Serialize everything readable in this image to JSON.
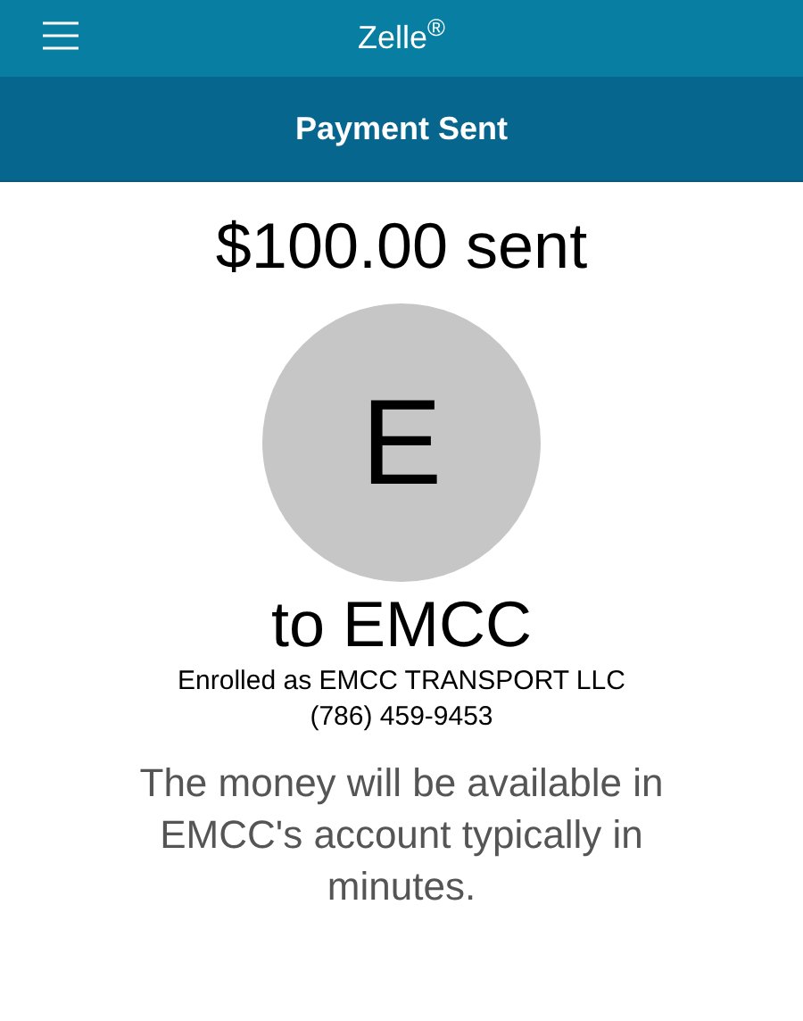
{
  "app_bar": {
    "title": "Zelle$^{®}$"
  },
  "header": {
    "title": "Payment Sent"
  },
  "amount": "$100.00 sent",
  "recipient": {
    "initial": "E",
    "name": "to EMCC",
    "enrolled": "Enrolled as EMCC TRANSPORT LLC",
    "phone": "(786) 459-9453"
  },
  "message": "The money will be available in EMCC's account typically in minutes."
}
